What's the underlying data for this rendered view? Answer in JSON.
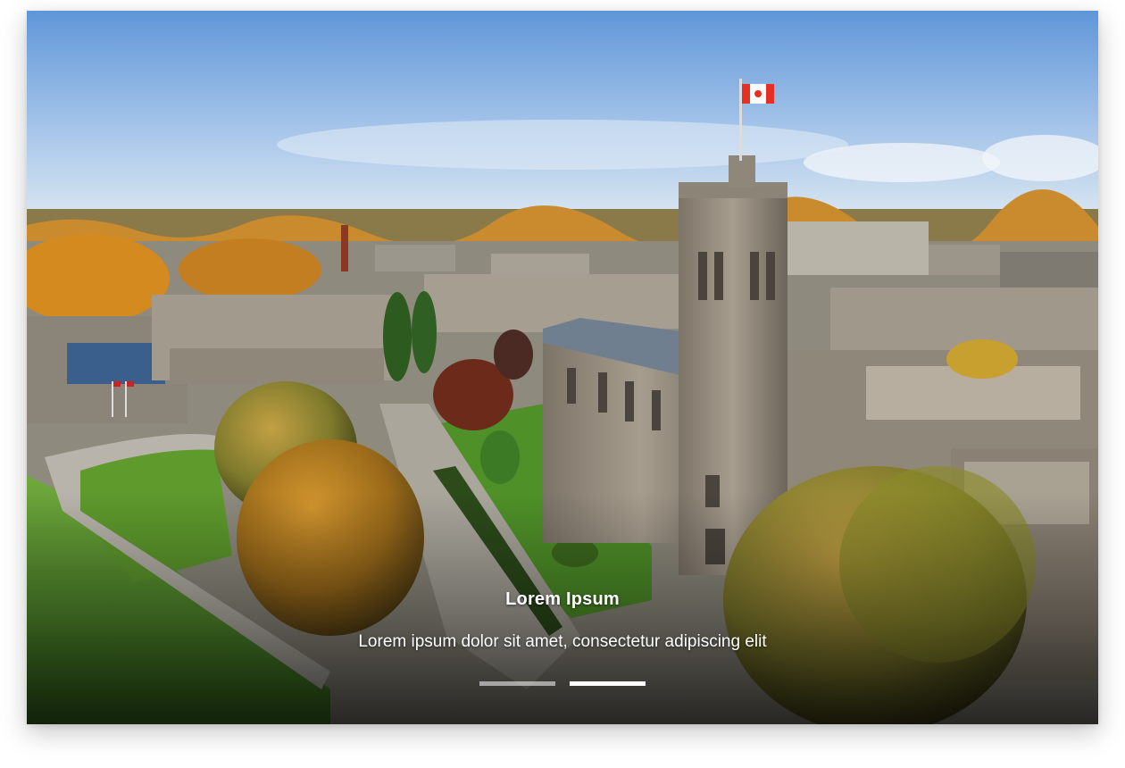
{
  "carousel": {
    "image": {
      "name": "aerial-campus-photo",
      "description_icon": "photo"
    },
    "caption": {
      "title": "Lorem Ipsum",
      "text": "Lorem ipsum dolor sit amet, consectetur adipiscing elit"
    },
    "slides_total": 2,
    "active_slide": 2,
    "colors": {
      "indicator_active": "#ffffff",
      "indicator_inactive": "#cfcfcf",
      "caption_text": "#ffffff"
    }
  }
}
